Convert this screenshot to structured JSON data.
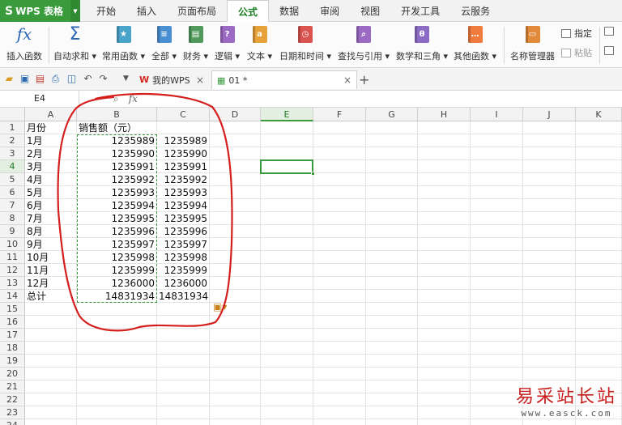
{
  "app": {
    "name": "WPS 表格",
    "logo_glyph": "S"
  },
  "menu_tabs": [
    {
      "label": "开始",
      "active": false
    },
    {
      "label": "插入",
      "active": false
    },
    {
      "label": "页面布局",
      "active": false
    },
    {
      "label": "公式",
      "active": true
    },
    {
      "label": "数据",
      "active": false
    },
    {
      "label": "审阅",
      "active": false
    },
    {
      "label": "视图",
      "active": false
    },
    {
      "label": "开发工具",
      "active": false
    },
    {
      "label": "云服务",
      "active": false
    }
  ],
  "ribbon": {
    "insert_function": "插入函数",
    "autosum": "自动求和",
    "common_functions": "常用函数",
    "all": "全部",
    "finance": "财务",
    "logic": "逻辑",
    "text": "文本",
    "datetime": "日期和时间",
    "lookup": "查找与引用",
    "math": "数学和三角",
    "other": "其他函数",
    "name_manager": "名称管理器",
    "specify": "指定",
    "paste": "粘贴",
    "colors": {
      "finance": "#4f9a5a",
      "logic": "#9b6bc4",
      "text": "#e8a23a",
      "datetime": "#d9534f",
      "lookup": "#9b6bc4",
      "math": "#8b6bc4",
      "other": "#f07b3f",
      "common": "#4aa3c9",
      "all": "#4a8fd1"
    }
  },
  "quickbar": {
    "tab_mywps": "我的WPS",
    "tab_file": "01 *"
  },
  "formula_bar": {
    "cell_ref": "E4",
    "fx": "fx",
    "value": ""
  },
  "columns": [
    "A",
    "B",
    "C",
    "D",
    "E",
    "F",
    "G",
    "H",
    "I",
    "J",
    "K"
  ],
  "active_column": "E",
  "active_row": 4,
  "rows": [
    "1",
    "2",
    "3",
    "4",
    "5",
    "6",
    "7",
    "8",
    "9",
    "10",
    "11",
    "12",
    "13",
    "14",
    "15",
    "16",
    "17",
    "18",
    "19",
    "20",
    "21",
    "22",
    "23",
    "24"
  ],
  "sheet": {
    "header": {
      "month": "月份",
      "sales": "销售额（元）"
    },
    "data": [
      {
        "month": "1月",
        "b": "1235989",
        "c": "1235989"
      },
      {
        "month": "2月",
        "b": "1235990",
        "c": "1235990"
      },
      {
        "month": "3月",
        "b": "1235991",
        "c": "1235991"
      },
      {
        "month": "4月",
        "b": "1235992",
        "c": "1235992"
      },
      {
        "month": "5月",
        "b": "1235993",
        "c": "1235993"
      },
      {
        "month": "6月",
        "b": "1235994",
        "c": "1235994"
      },
      {
        "month": "7月",
        "b": "1235995",
        "c": "1235995"
      },
      {
        "month": "8月",
        "b": "1235996",
        "c": "1235996"
      },
      {
        "month": "9月",
        "b": "1235997",
        "c": "1235997"
      },
      {
        "month": "10月",
        "b": "1235998",
        "c": "1235998"
      },
      {
        "month": "11月",
        "b": "1235999",
        "c": "1235999"
      },
      {
        "month": "12月",
        "b": "1236000",
        "c": "1236000"
      }
    ],
    "total": {
      "label": "总计",
      "b": "14831934",
      "c": "14831934"
    }
  },
  "watermark": {
    "line1": "易采站长站",
    "line2": "www.easck.com"
  },
  "annotation_color": "#d41f1f",
  "accent_color": "#3b9a3e"
}
